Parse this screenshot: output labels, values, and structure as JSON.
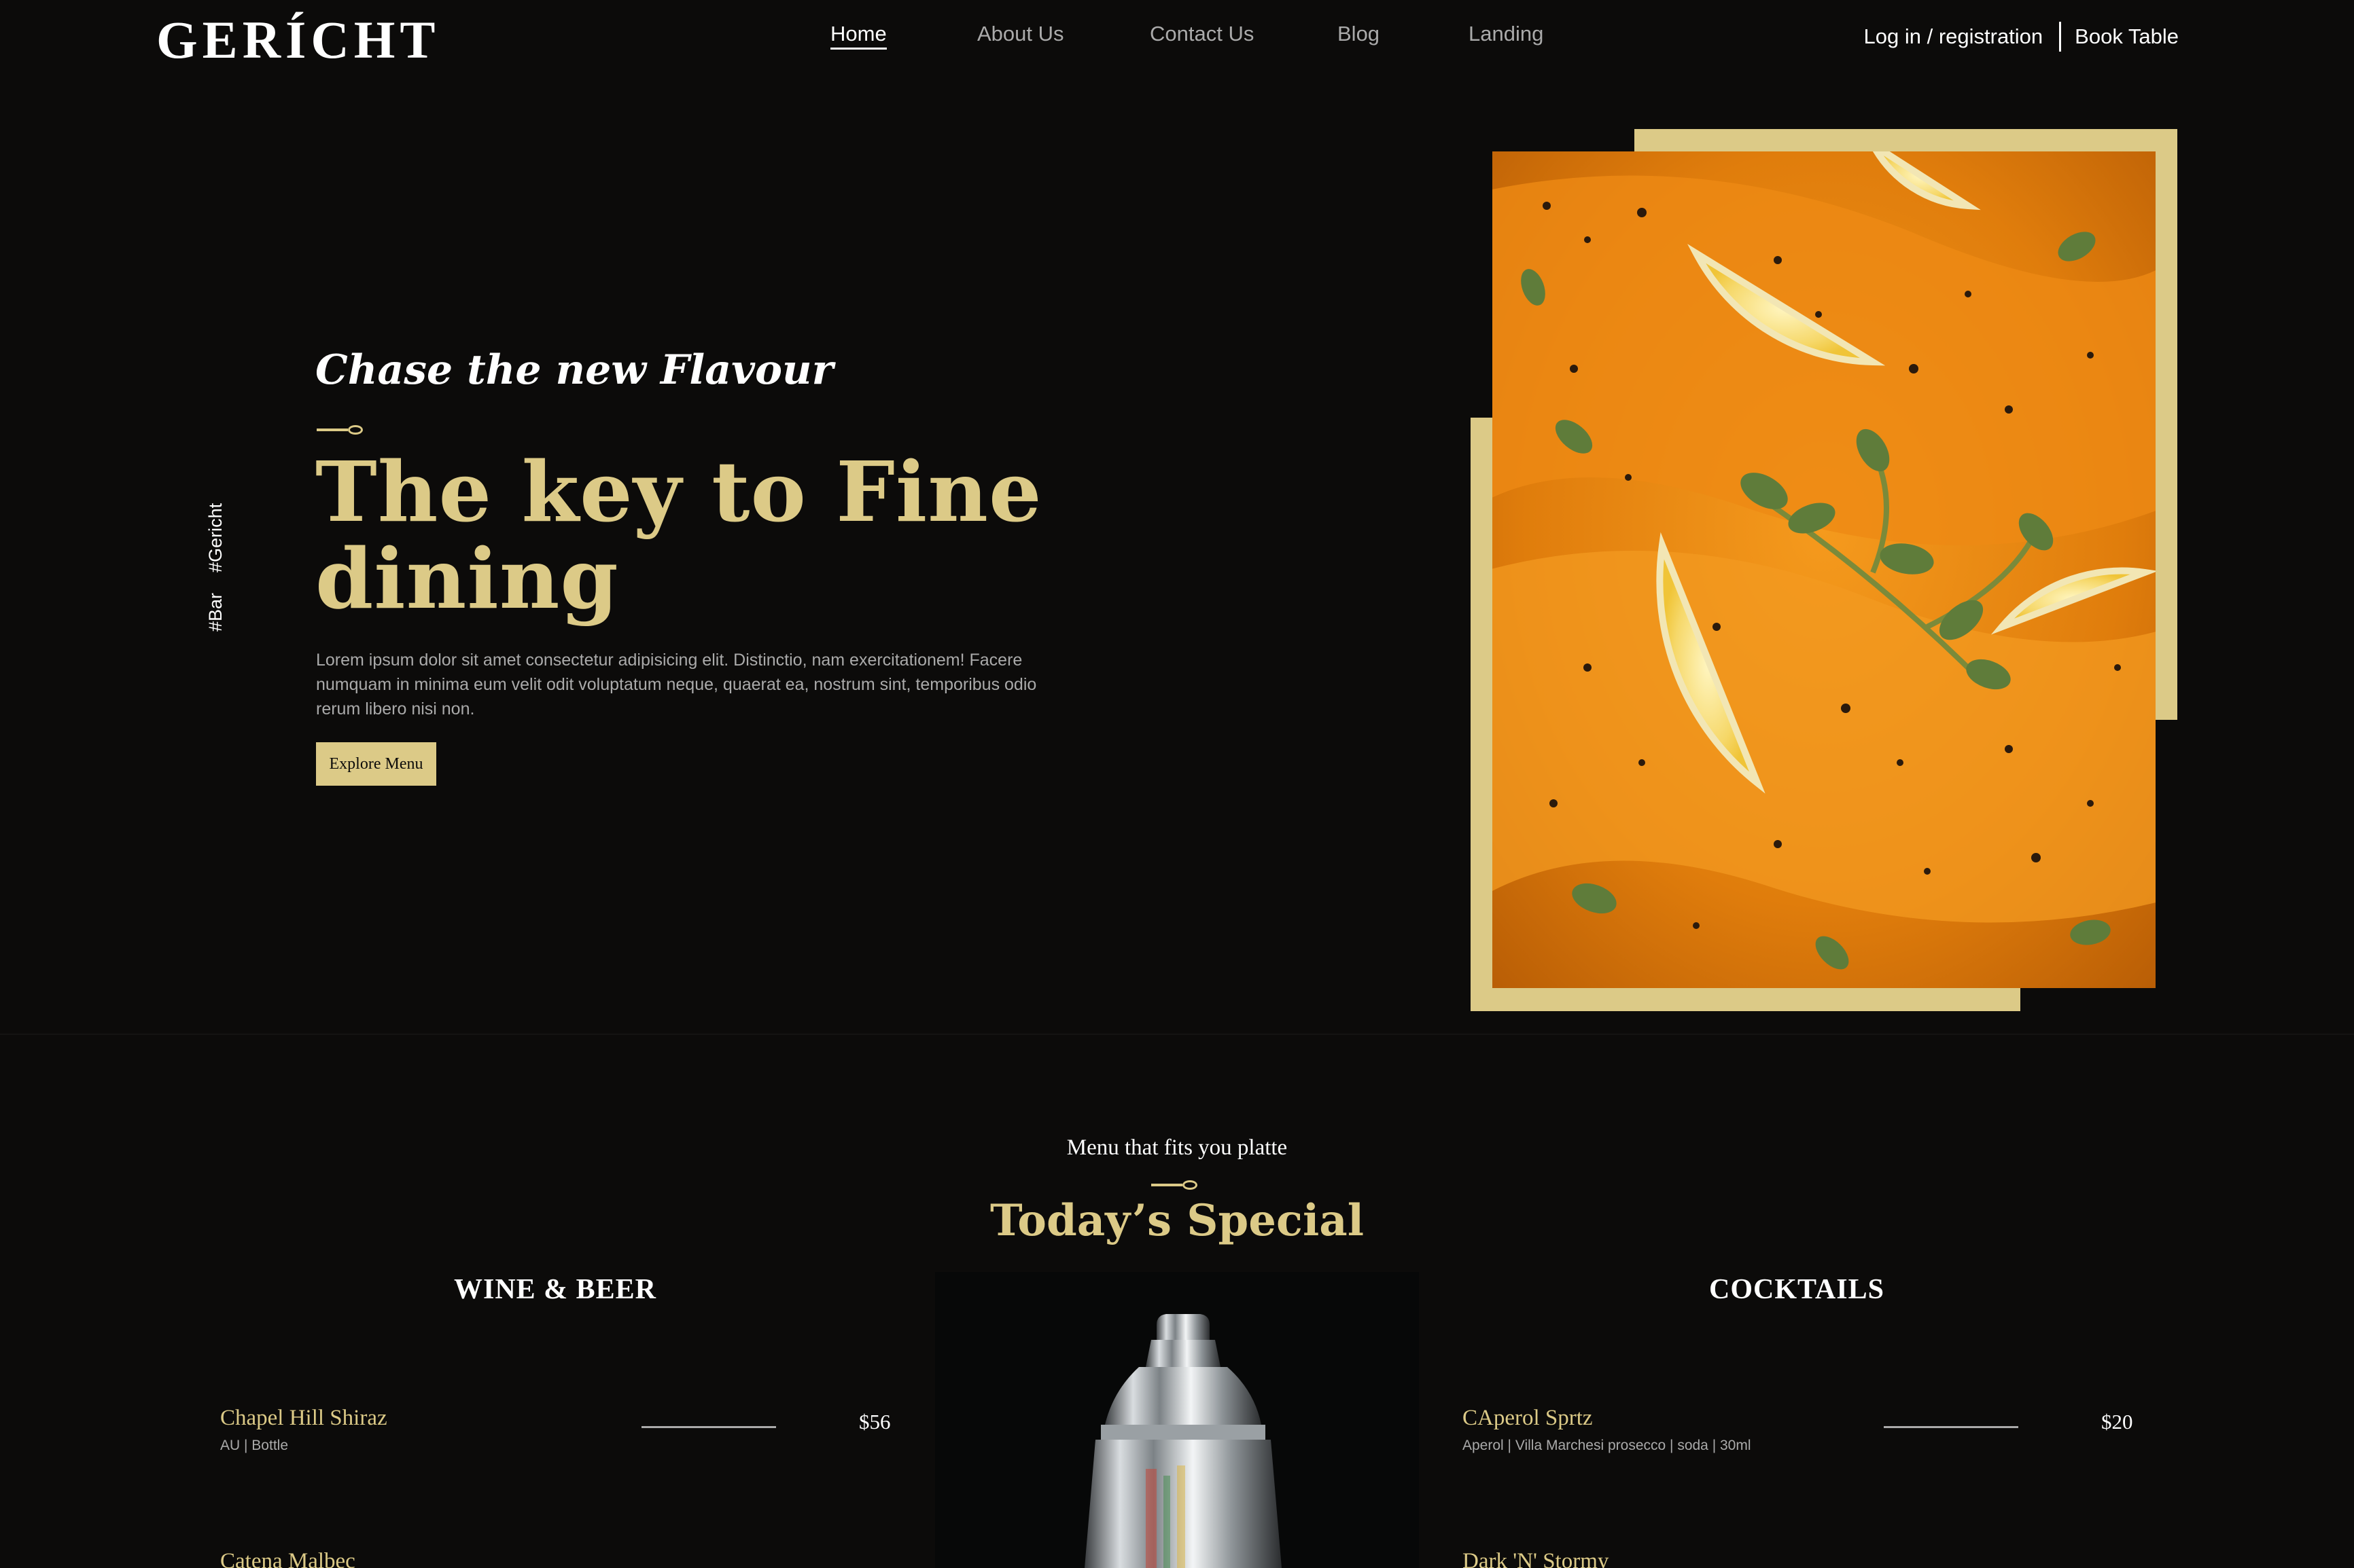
{
  "brand": {
    "logo": "GERÍCHT"
  },
  "nav": {
    "links": [
      {
        "label": "Home",
        "active": true
      },
      {
        "label": "About Us",
        "active": false
      },
      {
        "label": "Contact Us",
        "active": false
      },
      {
        "label": "Blog",
        "active": false
      },
      {
        "label": "Landing",
        "active": false
      }
    ],
    "login": "Log in / registration",
    "book_table": "Book Table"
  },
  "hero": {
    "side_tags": [
      "#Bar",
      "#Gericht"
    ],
    "subtitle": "Chase the new Flavour",
    "title": "The key to Fine dining",
    "description": "Lorem ipsum dolor sit amet consectetur adipisicing elit. Distinctio, nam exercitationem! Facere numquam in minima eum velit odit voluptatum neque, quaerat ea, nostrum sint, temporibus odio rerum libero nisi non.",
    "cta": "Explore Menu",
    "image_icon": "salmon-dish-image"
  },
  "special": {
    "subtitle": "Menu that fits you platte",
    "title": "Today’s Special",
    "wine": {
      "heading": "WINE & BEER",
      "items": [
        {
          "name": "Chapel Hill Shiraz",
          "tags": "AU | Bottle",
          "price": "$56"
        },
        {
          "name": "Catena Malbec",
          "tags": "",
          "price": ""
        }
      ]
    },
    "cocktails": {
      "heading": "COCKTAILS",
      "items": [
        {
          "name": "CAperol Sprtz",
          "tags": "Aperol | Villa Marchesi prosecco | soda | 30ml",
          "price": "$20"
        },
        {
          "name": "Dark 'N' Stormy",
          "tags": "",
          "price": ""
        }
      ]
    },
    "image_icon": "cocktail-shaker-image"
  },
  "colors": {
    "background": "#0c0b0a",
    "golden": "#dcca87",
    "white": "#ffffff",
    "grey": "#aaaaaa"
  }
}
